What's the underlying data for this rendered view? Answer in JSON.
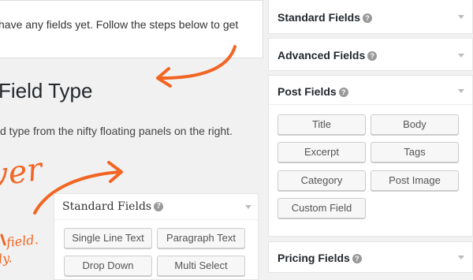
{
  "notice": {
    "text": "have any fields yet. Follow the steps below to get"
  },
  "heading": "Field Type",
  "instruction": "d type from the nifty floating panels on the right.",
  "scrawl": {
    "big_word": "ver",
    "small_line1": "field.",
    "small_line2": "ly.",
    "color": "#f26522"
  },
  "sample_panel": {
    "title": "Standard Fields",
    "buttons": [
      "Single Line Text",
      "Paragraph Text",
      "Drop Down",
      "Multi Select"
    ]
  },
  "right_panels": {
    "standard": {
      "title": "Standard Fields"
    },
    "advanced": {
      "title": "Advanced Fields"
    },
    "post": {
      "title": "Post Fields",
      "buttons": [
        "Title",
        "Body",
        "Excerpt",
        "Tags",
        "Category",
        "Post Image",
        "Custom Field"
      ]
    },
    "pricing": {
      "title": "Pricing Fields"
    }
  },
  "icons": {
    "help": "question-circle-icon",
    "collapse": "caret-down-icon",
    "arrow": "hand-drawn-arrow"
  },
  "help_glyph": "?"
}
